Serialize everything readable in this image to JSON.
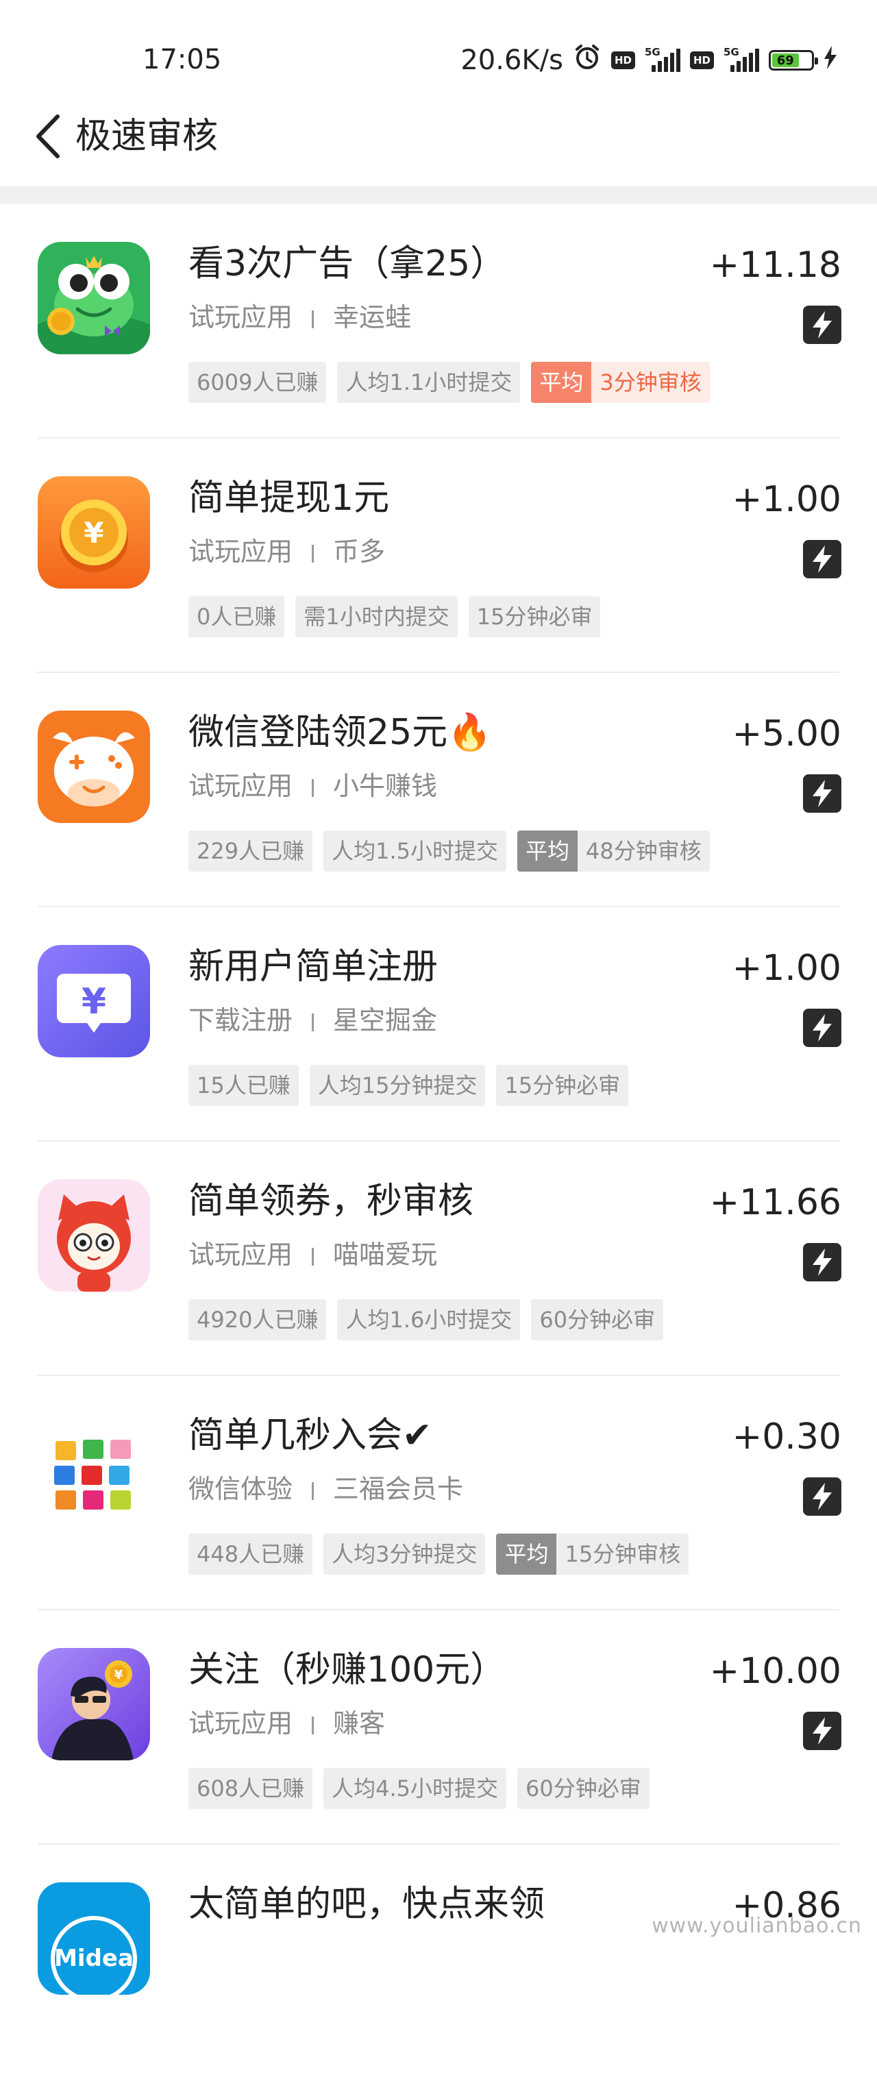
{
  "status_bar": {
    "time": "17:05",
    "network_speed": "20.6K/s",
    "hd_label": "HD",
    "signal_label": "5G",
    "battery_level": "69",
    "icons": [
      "alarm-icon",
      "hd-icon",
      "signal-5g-icon",
      "hd-icon",
      "signal-5g-icon",
      "battery-icon",
      "charging-icon"
    ]
  },
  "header": {
    "title": "极速审核",
    "back_icon": "chevron-left-icon"
  },
  "tasks": [
    {
      "title": "看3次广告（拿25）",
      "reward": "+11.18",
      "category": "试玩应用",
      "app_name": "幸运蛙",
      "earned": "6009人已赚",
      "avg_submit": "人均1.1小时提交",
      "review_label": "平均",
      "review": "3分钟审核",
      "review_style": "orange",
      "icon": "frog-app-icon"
    },
    {
      "title": "简单提现1元",
      "reward": "+1.00",
      "category": "试玩应用",
      "app_name": "币多",
      "earned": "0人已赚",
      "avg_submit": "需1小时内提交",
      "review": "15分钟必审",
      "icon": "coin-app-icon"
    },
    {
      "title": "微信登陆领25元🔥",
      "reward": "+5.00",
      "category": "试玩应用",
      "app_name": "小牛赚钱",
      "earned": "229人已赚",
      "avg_submit": "人均1.5小时提交",
      "review_label": "平均",
      "review": "48分钟审核",
      "review_style": "gray",
      "icon": "cow-app-icon"
    },
    {
      "title": "新用户简单注册",
      "reward": "+1.00",
      "category": "下载注册",
      "app_name": "星空掘金",
      "earned": "15人已赚",
      "avg_submit": "人均15分钟提交",
      "review": "15分钟必审",
      "icon": "yuan-chat-app-icon"
    },
    {
      "title": "简单领券，秒审核",
      "reward": "+11.66",
      "category": "试玩应用",
      "app_name": "喵喵爱玩",
      "earned": "4920人已赚",
      "avg_submit": "人均1.6小时提交",
      "review": "60分钟必审",
      "icon": "cat-app-icon"
    },
    {
      "title": "简单几秒入会✔",
      "reward": "+0.30",
      "category": "微信体验",
      "app_name": "三福会员卡",
      "earned": "448人已赚",
      "avg_submit": "人均3分钟提交",
      "review_label": "平均",
      "review": "15分钟审核",
      "review_style": "gray",
      "icon": "color-grid-app-icon"
    },
    {
      "title": "关注（秒赚100元）",
      "reward": "+10.00",
      "category": "试玩应用",
      "app_name": "赚客",
      "earned": "608人已赚",
      "avg_submit": "人均4.5小时提交",
      "review": "60分钟必审",
      "icon": "man-coin-app-icon"
    },
    {
      "title": "太简单的吧，快点来领",
      "reward": "+0.86",
      "icon": "midea-app-icon",
      "icon_text": "Midea"
    }
  ],
  "watermark": "www.youlianbao.cn"
}
